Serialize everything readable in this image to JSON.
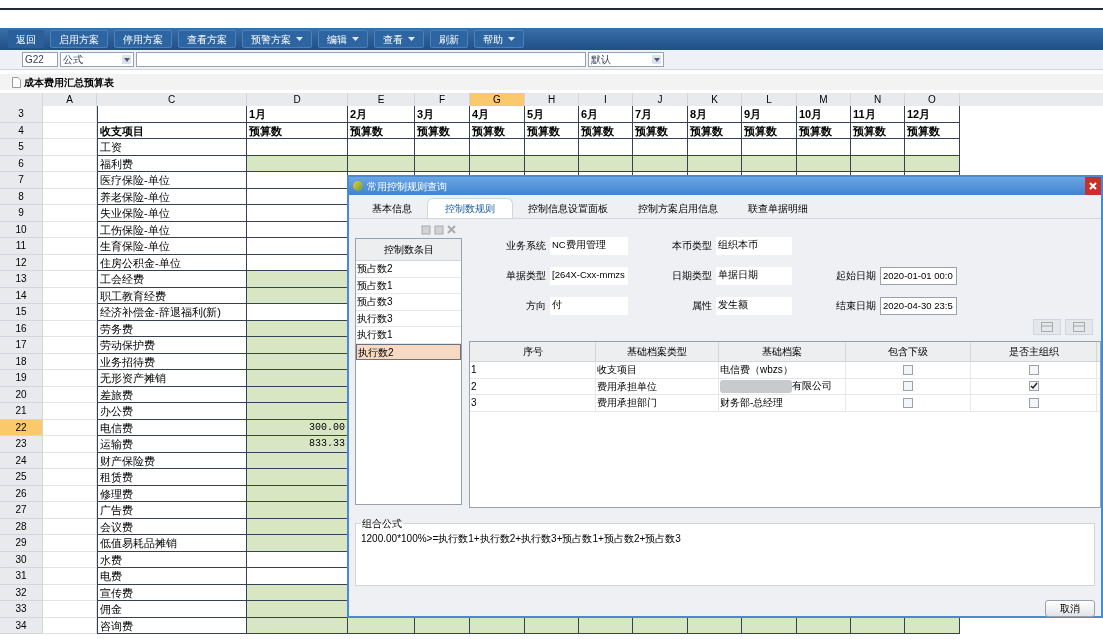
{
  "toolbar": {
    "buttons": [
      {
        "label": "返回",
        "dropdown": false
      },
      {
        "label": "启用方案",
        "dropdown": false
      },
      {
        "label": "停用方案",
        "dropdown": false
      },
      {
        "label": "查看方案",
        "dropdown": false
      },
      {
        "label": "预警方案",
        "dropdown": true
      },
      {
        "label": "编辑",
        "dropdown": true
      },
      {
        "label": "查看",
        "dropdown": true
      },
      {
        "label": "刷新",
        "dropdown": false
      },
      {
        "label": "帮助",
        "dropdown": true
      }
    ]
  },
  "formula_bar": {
    "cell_ref": "G22",
    "mode": "公式",
    "style": "默认"
  },
  "sheet": {
    "title": "成本费用汇总预算表",
    "columns": [
      {
        "letter": "A",
        "selected": false
      },
      {
        "letter": "C",
        "selected": false
      },
      {
        "letter": "D",
        "selected": false
      },
      {
        "letter": "E",
        "selected": false
      },
      {
        "letter": "F",
        "selected": false
      },
      {
        "letter": "G",
        "selected": true
      },
      {
        "letter": "H",
        "selected": false
      },
      {
        "letter": "I",
        "selected": false
      },
      {
        "letter": "J",
        "selected": false
      },
      {
        "letter": "K",
        "selected": false
      },
      {
        "letter": "L",
        "selected": false
      },
      {
        "letter": "M",
        "selected": false
      },
      {
        "letter": "N",
        "selected": false
      },
      {
        "letter": "O",
        "selected": false
      }
    ],
    "header_rows": [
      {
        "number": "3",
        "label": "",
        "months": [
          "1月",
          "2月",
          "3月",
          "4月",
          "5月",
          "6月",
          "7月",
          "8月",
          "9月",
          "10月",
          "11月",
          "12月"
        ]
      },
      {
        "number": "4",
        "label": "收支项目",
        "months": [
          "预算数",
          "预算数",
          "预算数",
          "预算数",
          "预算数",
          "预算数",
          "预算数",
          "预算数",
          "预算数",
          "预算数",
          "预算数",
          "预算数"
        ]
      }
    ],
    "rows": [
      {
        "number": "5",
        "selected": false,
        "label": "工资",
        "editable": false
      },
      {
        "number": "6",
        "selected": false,
        "label": "福利费",
        "editable": true
      },
      {
        "number": "7",
        "selected": false,
        "label": "医疗保险-单位",
        "editable": false
      },
      {
        "number": "8",
        "selected": false,
        "label": "养老保险-单位",
        "editable": false
      },
      {
        "number": "9",
        "selected": false,
        "label": "失业保险-单位",
        "editable": false
      },
      {
        "number": "10",
        "selected": false,
        "label": "工伤保险-单位",
        "editable": false
      },
      {
        "number": "11",
        "selected": false,
        "label": "生育保险-单位",
        "editable": false
      },
      {
        "number": "12",
        "selected": false,
        "label": "住房公积金-单位",
        "editable": false
      },
      {
        "number": "13",
        "selected": false,
        "label": "工会经费",
        "editable": true
      },
      {
        "number": "14",
        "selected": false,
        "label": "职工教育经费",
        "editable": true
      },
      {
        "number": "15",
        "selected": false,
        "label": "经济补偿金-辞退福利(新)",
        "editable": false
      },
      {
        "number": "16",
        "selected": false,
        "label": "劳务费",
        "editable": true
      },
      {
        "number": "17",
        "selected": false,
        "label": "劳动保护费",
        "editable": true
      },
      {
        "number": "18",
        "selected": false,
        "label": "业务招待费",
        "editable": true
      },
      {
        "number": "19",
        "selected": false,
        "label": "无形资产摊销",
        "editable": true
      },
      {
        "number": "20",
        "selected": false,
        "label": "差旅费",
        "editable": true
      },
      {
        "number": "21",
        "selected": false,
        "label": "办公费",
        "editable": true
      },
      {
        "number": "22",
        "selected": true,
        "label": "电信费",
        "editable": true,
        "january": "300.00"
      },
      {
        "number": "23",
        "selected": false,
        "label": "运输费",
        "editable": true,
        "january": "833.33"
      },
      {
        "number": "24",
        "selected": false,
        "label": "财产保险费",
        "editable": true
      },
      {
        "number": "25",
        "selected": false,
        "label": "租赁费",
        "editable": true
      },
      {
        "number": "26",
        "selected": false,
        "label": "修理费",
        "editable": true
      },
      {
        "number": "27",
        "selected": false,
        "label": "广告费",
        "editable": true
      },
      {
        "number": "28",
        "selected": false,
        "label": "会议费",
        "editable": true
      },
      {
        "number": "29",
        "selected": false,
        "label": "低值易耗品摊销",
        "editable": true
      },
      {
        "number": "30",
        "selected": false,
        "label": "水费",
        "editable": false
      },
      {
        "number": "31",
        "selected": false,
        "label": "电费",
        "editable": false
      },
      {
        "number": "32",
        "selected": false,
        "label": "宣传费",
        "editable": true
      },
      {
        "number": "33",
        "selected": false,
        "label": "佣金",
        "editable": true
      },
      {
        "number": "34",
        "selected": false,
        "label": "咨询费",
        "editable": true
      }
    ]
  },
  "dialog": {
    "title": "常用控制规则查询",
    "tabs": [
      {
        "label": "基本信息",
        "selected": false
      },
      {
        "label": "控制数规则",
        "selected": true
      },
      {
        "label": "控制信息设置面板",
        "selected": false
      },
      {
        "label": "控制方案启用信息",
        "selected": false
      },
      {
        "label": "联查单据明细",
        "selected": false
      }
    ],
    "list": {
      "header": "控制数条目",
      "items": [
        {
          "label": "预占数2",
          "selected": false
        },
        {
          "label": "预占数1",
          "selected": false
        },
        {
          "label": "预占数3",
          "selected": false
        },
        {
          "label": "执行数3",
          "selected": false
        },
        {
          "label": "执行数1",
          "selected": false
        },
        {
          "label": "执行数2",
          "selected": true
        }
      ]
    },
    "fields": [
      {
        "label": "业务系统",
        "value": "NC费用管理",
        "kind": "plain"
      },
      {
        "label": "本币类型",
        "value": "组织本币",
        "kind": "plain"
      },
      {
        "kind": "empty"
      },
      {
        "label": "单据类型",
        "value": "[264X-Cxx-mmzs",
        "kind": "plain"
      },
      {
        "label": "日期类型",
        "value": "单据日期",
        "kind": "plain"
      },
      {
        "label": "起始日期",
        "value": "2020-01-01 00:0",
        "kind": "boxed"
      },
      {
        "label": "方向",
        "value": "付",
        "kind": "plain"
      },
      {
        "label": "属性",
        "value": "发生额",
        "kind": "plain"
      },
      {
        "label": "结束日期",
        "value": "2020-04-30 23:5",
        "kind": "boxed"
      }
    ],
    "table": {
      "columns": [
        "序号",
        "基础档案类型",
        "基础档案",
        "包含下级",
        "是否主组织"
      ],
      "rows": [
        {
          "index": "1",
          "type": "收支项目",
          "record": "电信费（wbzs）",
          "redacted": false,
          "include_children": false,
          "main_org": false
        },
        {
          "index": "2",
          "type": "费用承担单位",
          "record": "有限公司",
          "redacted": true,
          "include_children": false,
          "main_org": true
        },
        {
          "index": "3",
          "type": "费用承担部门",
          "record": "财务部-总经理",
          "redacted": false,
          "include_children": false,
          "main_org": false
        }
      ]
    },
    "formula": {
      "legend": "组合公式",
      "text": "1200.00*100%>=执行数1+执行数2+执行数3+预占数1+预占数2+预占数3"
    },
    "cancel": "取消"
  }
}
